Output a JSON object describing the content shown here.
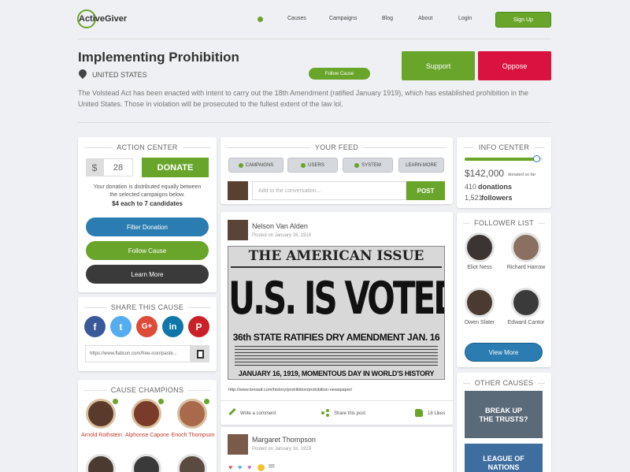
{
  "brand": {
    "logo_text": "ActiveGiver"
  },
  "nav": {
    "items": [
      "Causes",
      "Campaigns",
      "Blog",
      "About",
      "Login"
    ],
    "signup": "Sign Up"
  },
  "cause": {
    "title": "Implementing Prohibition",
    "location": "UNITED STATES",
    "follow": "Follow Cause",
    "support": "Support",
    "oppose": "Oppose",
    "description": "The Volstead Act has been enacted with intent to carry out the 18th Amendment (ratified January 1919), which has established prohibition in the United States. Those in violation will be prosecuted to the fullest extent of the law lol."
  },
  "action_center": {
    "title": "ACTION CENTER",
    "currency": "$",
    "amount": "28",
    "donate": "DONATE",
    "note": "Your donation is distributed equally between the selected campaigns below.",
    "split": "$4 each to 7 candidates",
    "filter": "Filter Donation",
    "follow": "Follow Cause",
    "learn": "Learn More"
  },
  "share": {
    "title": "SHARE THIS CAUSE",
    "url": "https://www.flaticon.com/free-icon/paste..."
  },
  "champions": {
    "title": "CAUSE CHAMPIONS",
    "people": [
      {
        "name": "Arnold Rothstein"
      },
      {
        "name": "Alphonse Capone"
      },
      {
        "name": "Enoch Thompson"
      }
    ]
  },
  "feed": {
    "title": "YOUR FEED",
    "tabs": [
      "CAMPAIGNS",
      "USERS",
      "SYSTEM",
      "LEARN MORE"
    ],
    "placeholder": "Add to the conversation...",
    "post": "POST",
    "post1": {
      "author": "Nelson Van Alden",
      "date": "Posted on January 16, 1919",
      "img_title": "THE AMERICAN ISSUE",
      "img_headline": "U.S. IS VOTED DRY",
      "img_sub": "36th STATE RATIFIES DRY AMENDMENT JAN. 16",
      "img_bottom": "JANUARY 16, 1919, MOMENTOUS DAY IN WORLD'S HISTORY",
      "link": "http://www.brewaf.com/history/prohibition/prohibition-newspaper/",
      "comment": "Write a comment",
      "share": "Share this post",
      "likes": "18 Likes"
    },
    "post2": {
      "author": "Margaret Thompson",
      "date": "Posted on January 16, 1919",
      "text": "!!!!"
    }
  },
  "info": {
    "title": "INFO CENTER",
    "progress": 0.92,
    "amount": "$142,000",
    "amount_note": "donated so far",
    "donations_n": "410",
    "donations": "donations",
    "followers_n": "1,521",
    "followers": "followers"
  },
  "followers": {
    "title": "FOLLOWER LIST",
    "people": [
      {
        "name": "Eliot Ness"
      },
      {
        "name": "Richard Harrow"
      },
      {
        "name": "Owen Slater"
      },
      {
        "name": "Edward Cantor"
      }
    ],
    "view_more": "View More"
  },
  "other": {
    "title": "OTHER CAUSES",
    "items": [
      "BREAK UP THE TRUSTS?",
      "LEAGUE OF NATIONS"
    ]
  },
  "colors": {
    "green": "#6aa52b",
    "red": "#d9123f",
    "blue": "#2b7cb0",
    "dark": "#333333"
  }
}
